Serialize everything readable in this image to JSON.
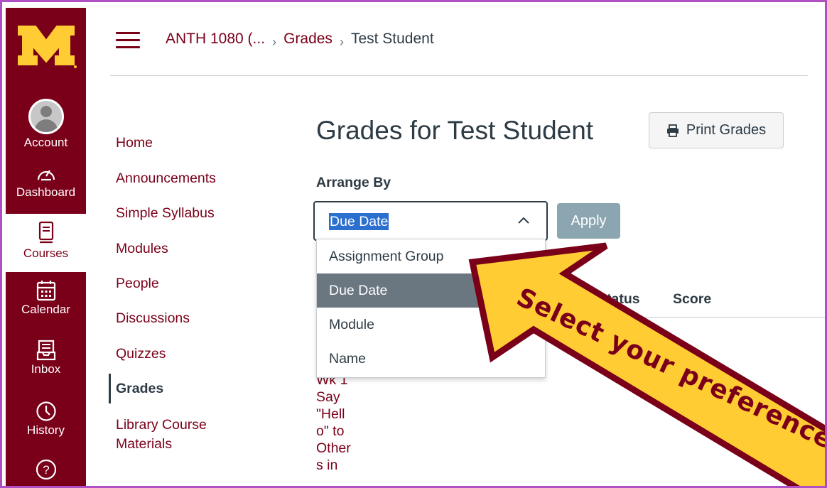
{
  "global_nav": {
    "items": [
      {
        "label": "Account",
        "icon": "avatar"
      },
      {
        "label": "Dashboard",
        "icon": "dashboard-icon"
      },
      {
        "label": "Courses",
        "icon": "book-icon"
      },
      {
        "label": "Calendar",
        "icon": "calendar-icon"
      },
      {
        "label": "Inbox",
        "icon": "inbox-icon"
      },
      {
        "label": "History",
        "icon": "clock-icon"
      },
      {
        "label": "",
        "icon": "help-icon"
      }
    ],
    "help_symbol": "?"
  },
  "breadcrumb": {
    "course": "ANTH 1080 (...",
    "section": "Grades",
    "current": "Test Student",
    "separator": "›"
  },
  "course_nav": {
    "items": [
      {
        "label": "Home"
      },
      {
        "label": "Announcements"
      },
      {
        "label": "Simple Syllabus"
      },
      {
        "label": "Modules"
      },
      {
        "label": "People"
      },
      {
        "label": "Discussions"
      },
      {
        "label": "Quizzes"
      },
      {
        "label": "Grades"
      },
      {
        "label": "Library Course\nMaterials"
      }
    ]
  },
  "main": {
    "title": "Grades for Test Student",
    "print_button": "Print Grades",
    "arrange_label": "Arrange By",
    "select_value": "Due Date",
    "apply_button": "Apply",
    "dropdown_options": [
      "Assignment Group",
      "Due Date",
      "Module",
      "Name"
    ],
    "columns": {
      "status": "Status",
      "score": "Score"
    },
    "assignment_text": "Wk 1\nSay\n\"Hell\no\" to\nOther\ns in"
  },
  "callout": {
    "text": "Select your preference"
  },
  "colors": {
    "maroon": "#7a0019",
    "gold": "#ffcc33",
    "text": "#2d3b45",
    "selected_option": "#6b7780",
    "apply": "#8ba6b0",
    "selection": "#2b6fcf",
    "frame": "#b04fc4"
  }
}
